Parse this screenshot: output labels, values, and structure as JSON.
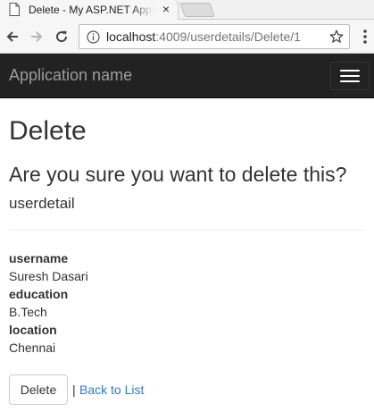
{
  "browser": {
    "tab_title": "Delete - My ASP.NET Application",
    "tab_close": "×",
    "url_host": "localhost",
    "url_rest": ":4009/userdetails/Delete/1",
    "icons": {
      "tab": "page-icon",
      "back": "arrow-left-icon",
      "forward": "arrow-right-icon",
      "reload": "reload-icon",
      "info": "info-icon",
      "bookmark": "star-icon",
      "menu": "kebab-menu-icon"
    }
  },
  "navbar": {
    "brand": "Application name",
    "toggle_icon": "hamburger-icon",
    "background": "#222222",
    "brand_color": "#9d9d9d"
  },
  "page": {
    "title": "Delete",
    "confirm_question": "Are you sure you want to delete this?",
    "model_name": "userdetail",
    "fields": [
      {
        "label": "username",
        "value": "Suresh Dasari"
      },
      {
        "label": "education",
        "value": "B.Tech"
      },
      {
        "label": "location",
        "value": "Chennai"
      }
    ],
    "delete_button": "Delete",
    "separator": "|",
    "back_link": "Back to List",
    "link_color": "#337ab7"
  }
}
